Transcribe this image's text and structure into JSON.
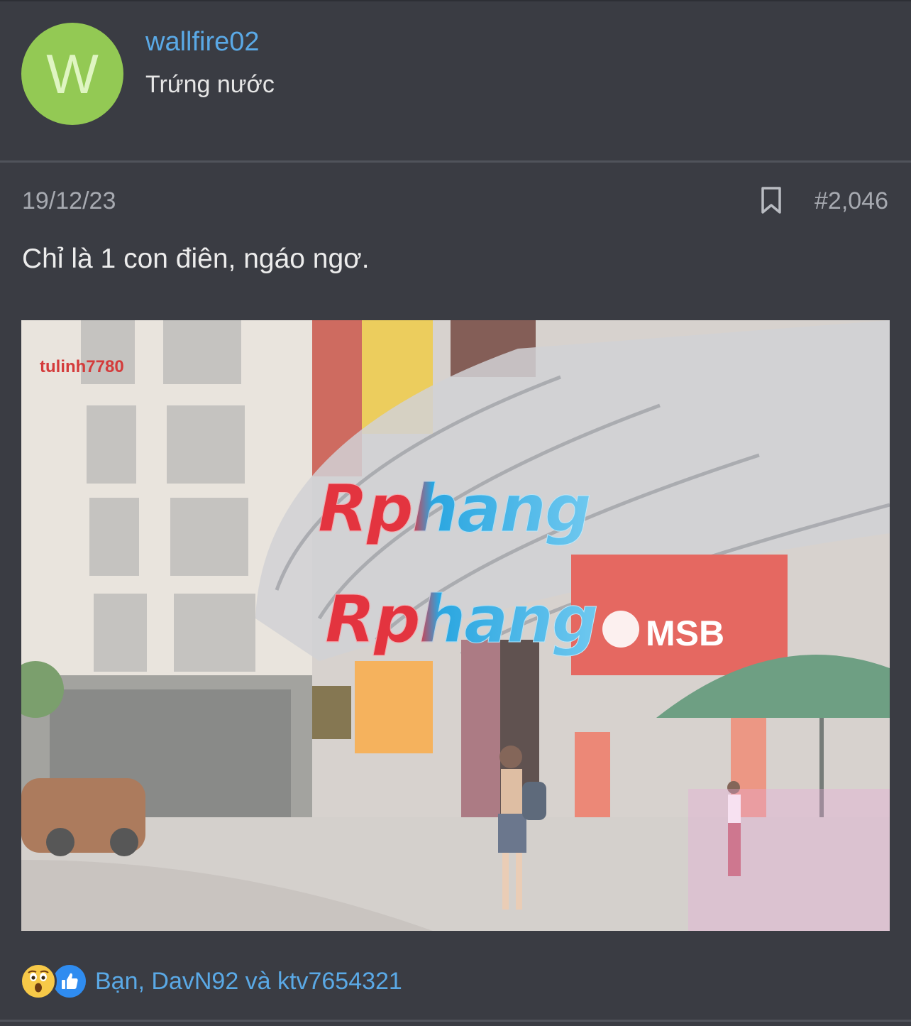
{
  "user": {
    "avatar_letter": "W",
    "avatar_color": "#93c954",
    "name": "wallfire02",
    "title": "Trứng nước"
  },
  "post": {
    "date": "19/12/23",
    "number": "#2,046",
    "text": "Chỉ là 1 con điên, ngáo ngơ.",
    "bookmark_icon": "bookmark-icon"
  },
  "image": {
    "watermark_user": "tulinh7780",
    "watermark_brand": "Rphang",
    "sign_text": "MSB"
  },
  "reactions": {
    "icons": [
      "wow-emoji-icon",
      "like-thumb-icon"
    ],
    "names": "Bạn, DavN92 và ktv7654321"
  },
  "colors": {
    "background": "#3a3c43",
    "link": "#5aa9e6",
    "muted": "#a7aab1"
  }
}
